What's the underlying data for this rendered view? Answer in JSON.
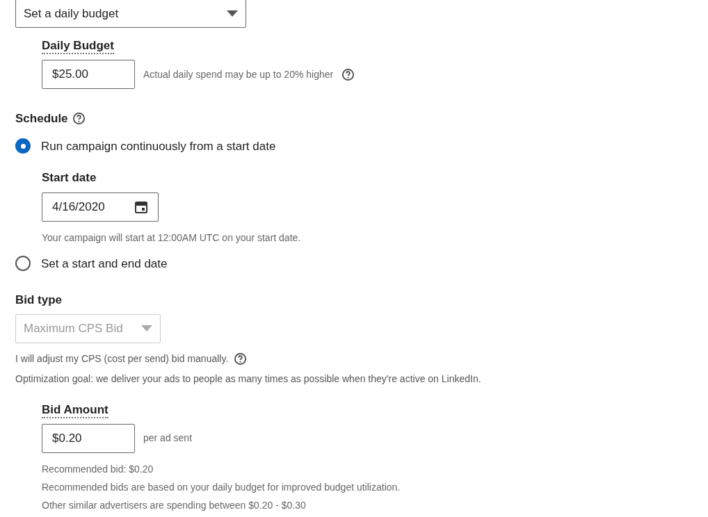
{
  "budget_select": {
    "value": "Set a daily budget"
  },
  "daily_budget": {
    "label": "Daily Budget",
    "value": "$25.00",
    "hint": "Actual daily spend may be up to 20% higher"
  },
  "schedule": {
    "label": "Schedule",
    "options": [
      {
        "label": "Run campaign continuously from a start date",
        "selected": true,
        "start_date_label": "Start date",
        "start_date": "4/16/2020",
        "note": "Your campaign will start at 12:00AM UTC on your start date."
      },
      {
        "label": "Set a start and end date",
        "selected": false
      }
    ]
  },
  "bid_type": {
    "label": "Bid type",
    "value": "Maximum CPS Bid",
    "disabled": true,
    "notes": [
      "I will adjust my CPS (cost per send) bid manually.",
      "Optimization goal: we deliver your ads to people as many times as possible when they're active on LinkedIn."
    ]
  },
  "bid_amount": {
    "label": "Bid Amount",
    "value": "$0.20",
    "unit": "per ad sent",
    "notes": [
      "Recommended bid: $0.20",
      "Recommended bids are based on your daily budget for improved budget utilization.",
      "Other similar advertisers are spending between $0.20 - $0.30"
    ]
  }
}
